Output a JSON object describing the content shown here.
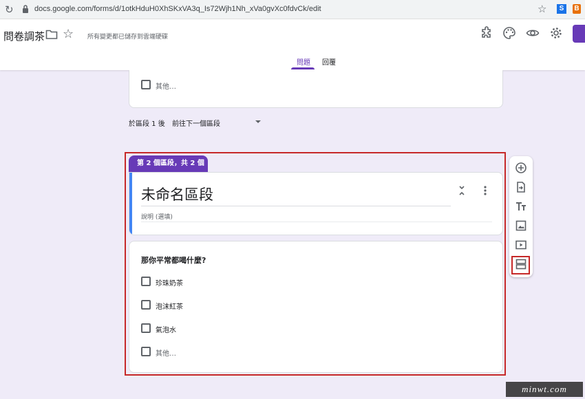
{
  "browser": {
    "url": "docs.google.com/forms/d/1otkHduH0XhSKxVA3q_Is72Wjh1Nh_xVa0gvXc0fdvCk/edit",
    "extension_s": "S",
    "extension_b": "B"
  },
  "header": {
    "title": "問卷調茶",
    "saved_status": "所有變更都已儲存到雲端硬碟",
    "icons": [
      "addon-icon",
      "palette-icon",
      "preview-eye-icon",
      "settings-gear-icon"
    ],
    "tabs": [
      {
        "label": "問題",
        "active": true
      },
      {
        "label": "回覆",
        "active": false
      }
    ],
    "accent_color": "#673ab7"
  },
  "section1": {
    "other_option": "其他…",
    "after_section_label": "於區段 1 後",
    "goto_value": "前往下一個區段"
  },
  "section2": {
    "badge": "第 2 個區段，共 2 個",
    "title": "未命名區段",
    "description_placeholder": "說明 (選填)"
  },
  "question": {
    "title": "那你平常都喝什麼?",
    "options": [
      "珍珠奶茶",
      "泡沫紅茶",
      "氣泡水"
    ],
    "other_option": "其他…"
  },
  "toolbar": {
    "items": [
      "add-question-icon",
      "import-questions-icon",
      "add-title-icon",
      "add-image-icon",
      "add-video-icon",
      "add-section-icon"
    ]
  },
  "watermark": "minwt.com"
}
